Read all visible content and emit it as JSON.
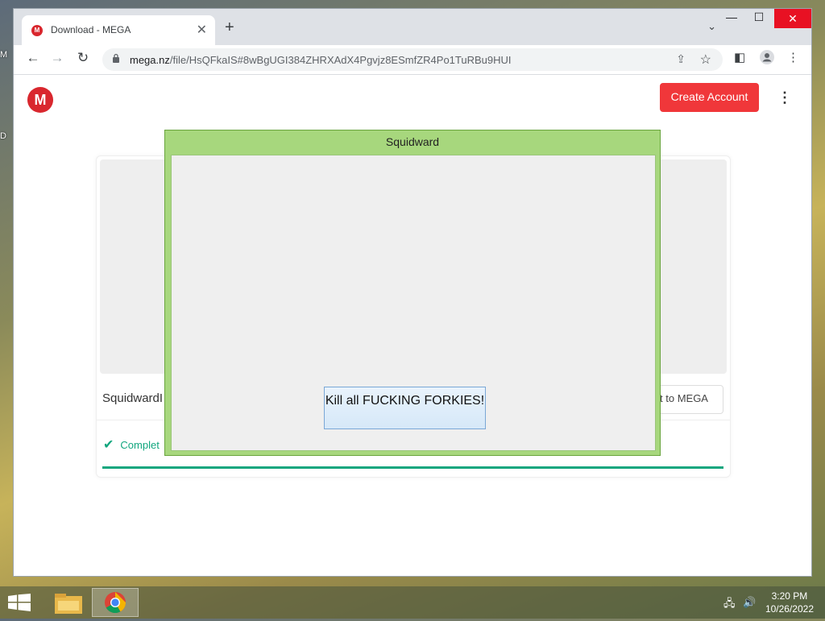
{
  "desktop": {
    "edge_label_1": "M",
    "edge_label_2": "D"
  },
  "browser": {
    "tab": {
      "title": "Download - MEGA",
      "favicon_letter": "M",
      "close": "✕"
    },
    "new_tab": "+",
    "tab_search": "⌄",
    "window_controls": {
      "minimize": "—",
      "maximize": "☐",
      "close": "✕"
    },
    "url_host": "mega.nz",
    "url_path": "/file/HsQFkaIS#8wBgUGI384ZHRXAdX4Pgvjz8ESmfZR4Po1TuRBu9HUI"
  },
  "mega": {
    "logo_letter": "M",
    "create_account": "Create Account",
    "filename_visible": "SquidwardI",
    "import_visible": "t to MEGA",
    "status_visible": "Complet",
    "progress": 1.0,
    "accent": "#12a67e",
    "brand": "#d9272e"
  },
  "popup": {
    "title": "Squidward",
    "button_label": "Kill all FUCKING FORKIES!"
  },
  "taskbar": {
    "time": "3:20 PM",
    "date": "10/26/2022"
  }
}
